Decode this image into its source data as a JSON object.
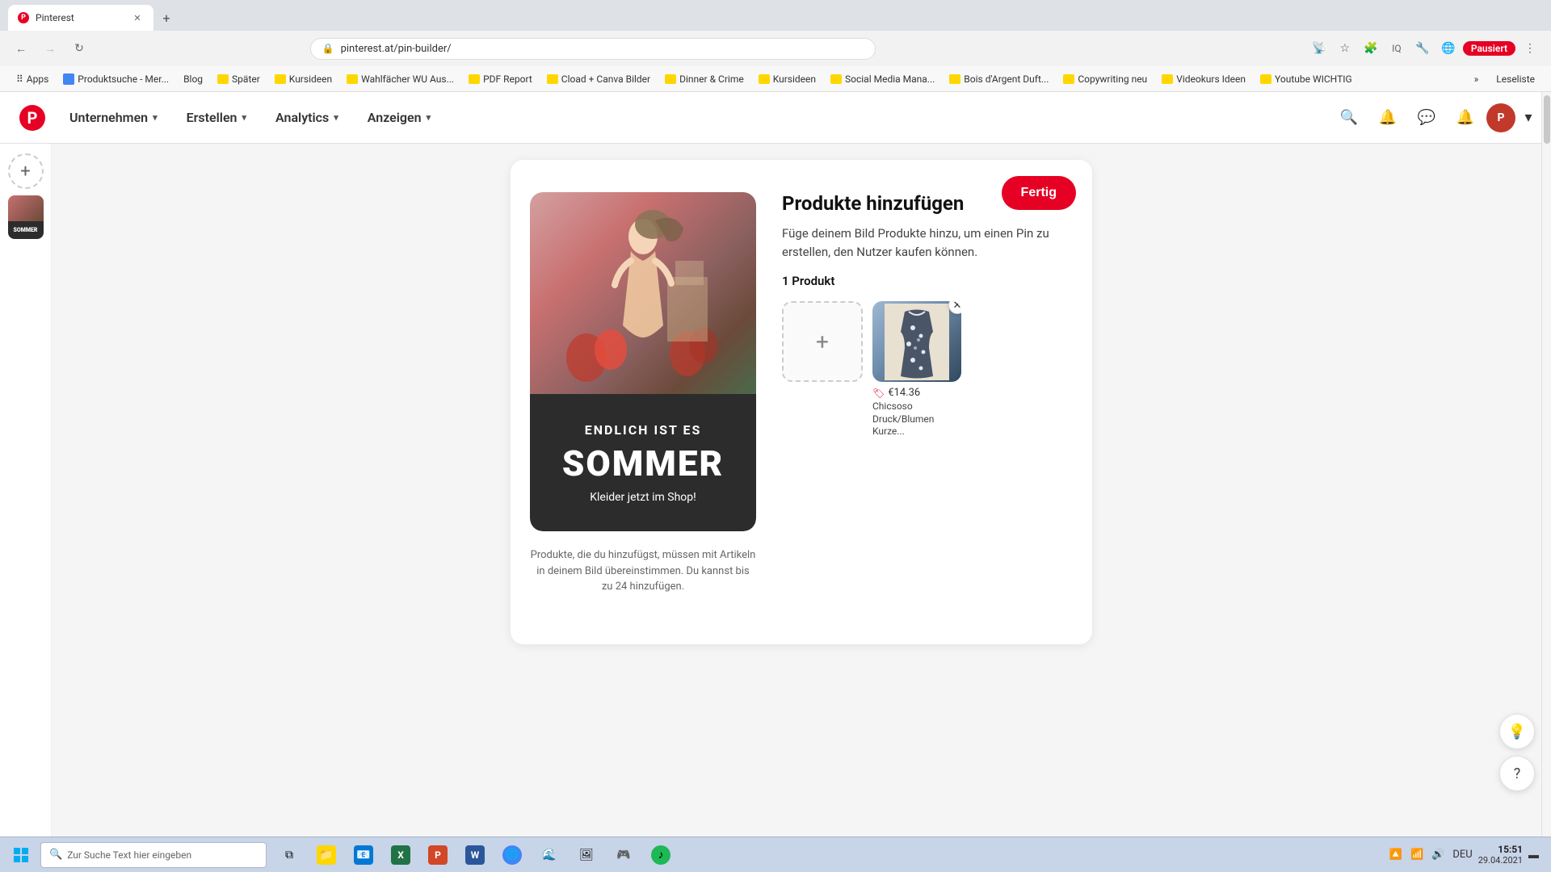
{
  "browser": {
    "tab": {
      "title": "Pinterest",
      "favicon": "P"
    },
    "url": "pinterest.at/pin-builder/",
    "profile_label": "Pausiert",
    "bookmarks": [
      {
        "label": "Apps",
        "type": "text"
      },
      {
        "label": "Produktsuche - Mer...",
        "type": "favicon",
        "color": "#4285f4"
      },
      {
        "label": "Blog",
        "type": "text"
      },
      {
        "label": "Später",
        "type": "folder"
      },
      {
        "label": "Kursideen",
        "type": "folder"
      },
      {
        "label": "Wahlfächer WU Aus...",
        "type": "folder"
      },
      {
        "label": "PDF Report",
        "type": "folder"
      },
      {
        "label": "Cload + Canva Bilder",
        "type": "folder"
      },
      {
        "label": "Dinner & Crime",
        "type": "folder"
      },
      {
        "label": "Kursideen",
        "type": "folder"
      },
      {
        "label": "Social Media Mana...",
        "type": "folder"
      },
      {
        "label": "Bois d'Argent Duft...",
        "type": "folder"
      },
      {
        "label": "Copywriting neu",
        "type": "folder"
      },
      {
        "label": "Videokurs Ideen",
        "type": "folder"
      },
      {
        "label": "Youtube WICHTIG",
        "type": "folder"
      },
      {
        "label": "Leseliste",
        "type": "text"
      }
    ]
  },
  "nav": {
    "logo": "P",
    "menu_items": [
      {
        "label": "Unternehmen",
        "has_chevron": true
      },
      {
        "label": "Erstellen",
        "has_chevron": true
      },
      {
        "label": "Analytics",
        "has_chevron": true
      },
      {
        "label": "Anzeigen",
        "has_chevron": true
      }
    ]
  },
  "sidebar": {
    "add_btn_label": "+",
    "thumbnail_alt": "Pin thumbnail"
  },
  "pin_builder": {
    "fertig_label": "Fertig",
    "section_title": "Produkte hinzufügen",
    "section_desc": "Füge deinem Bild Produkte hinzu, um einen Pin zu erstellen, den Nutzer kaufen können.",
    "product_count_label": "1 Produkt",
    "pin_image": {
      "text_line1": "ENDLICH IST ES",
      "text_line2": "SOMMER",
      "text_line3": "Kleider jetzt im Shop!"
    },
    "products": [
      {
        "price": "€14.36",
        "name": "Chicsoso Druck/Blumen Kurze...",
        "has_remove": true
      }
    ],
    "add_product_label": "+",
    "footer_text": "Produkte, die du hinzufügst, müssen mit Artikeln in deinem Bild übereinstimmen. Du kannst bis zu 24 hinzufügen."
  },
  "taskbar": {
    "search_placeholder": "Zur Suche Text hier eingeben",
    "time": "15:51",
    "date": "29.04.2021",
    "language": "DEU",
    "apps": [
      "⊞",
      "🔍",
      "📁",
      "📧",
      "📊",
      "📝",
      "🎵",
      "🌐",
      "📷",
      "🎮",
      "🎯",
      "🎵"
    ]
  },
  "colors": {
    "pinterest_red": "#e60023",
    "nav_bg": "#ffffff",
    "fertig_bg": "#e60023",
    "accent": "#e60023"
  }
}
